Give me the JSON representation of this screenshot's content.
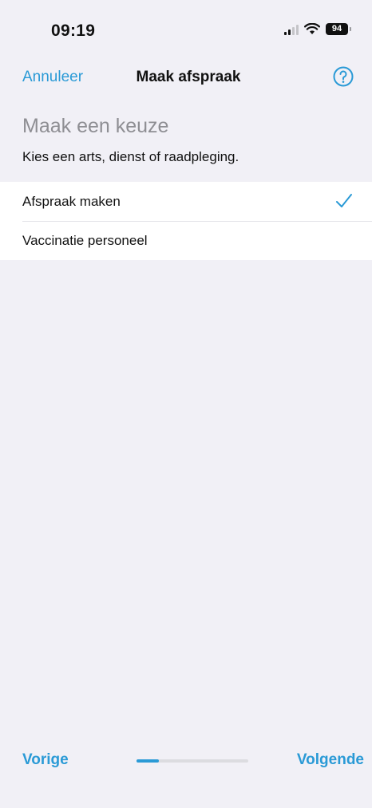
{
  "status_bar": {
    "time": "09:19",
    "battery": "94",
    "icons": [
      "signal-icon",
      "wifi-icon",
      "battery-icon"
    ]
  },
  "nav": {
    "cancel_label": "Annuleer",
    "title": "Maak afspraak",
    "help_icon": "help-circle-icon"
  },
  "content": {
    "title": "Maak een keuze",
    "subtitle": "Kies een arts, dienst of raadpleging."
  },
  "options": [
    {
      "label": "Afspraak maken",
      "selected": true
    },
    {
      "label": "Vaccinatie personeel",
      "selected": false
    }
  ],
  "footer": {
    "prev_label": "Vorige",
    "next_label": "Volgende",
    "progress": 0.2
  },
  "colors": {
    "accent": "#2a9ad6",
    "background": "#f1f0f6",
    "muted_text": "#8e8e93"
  }
}
